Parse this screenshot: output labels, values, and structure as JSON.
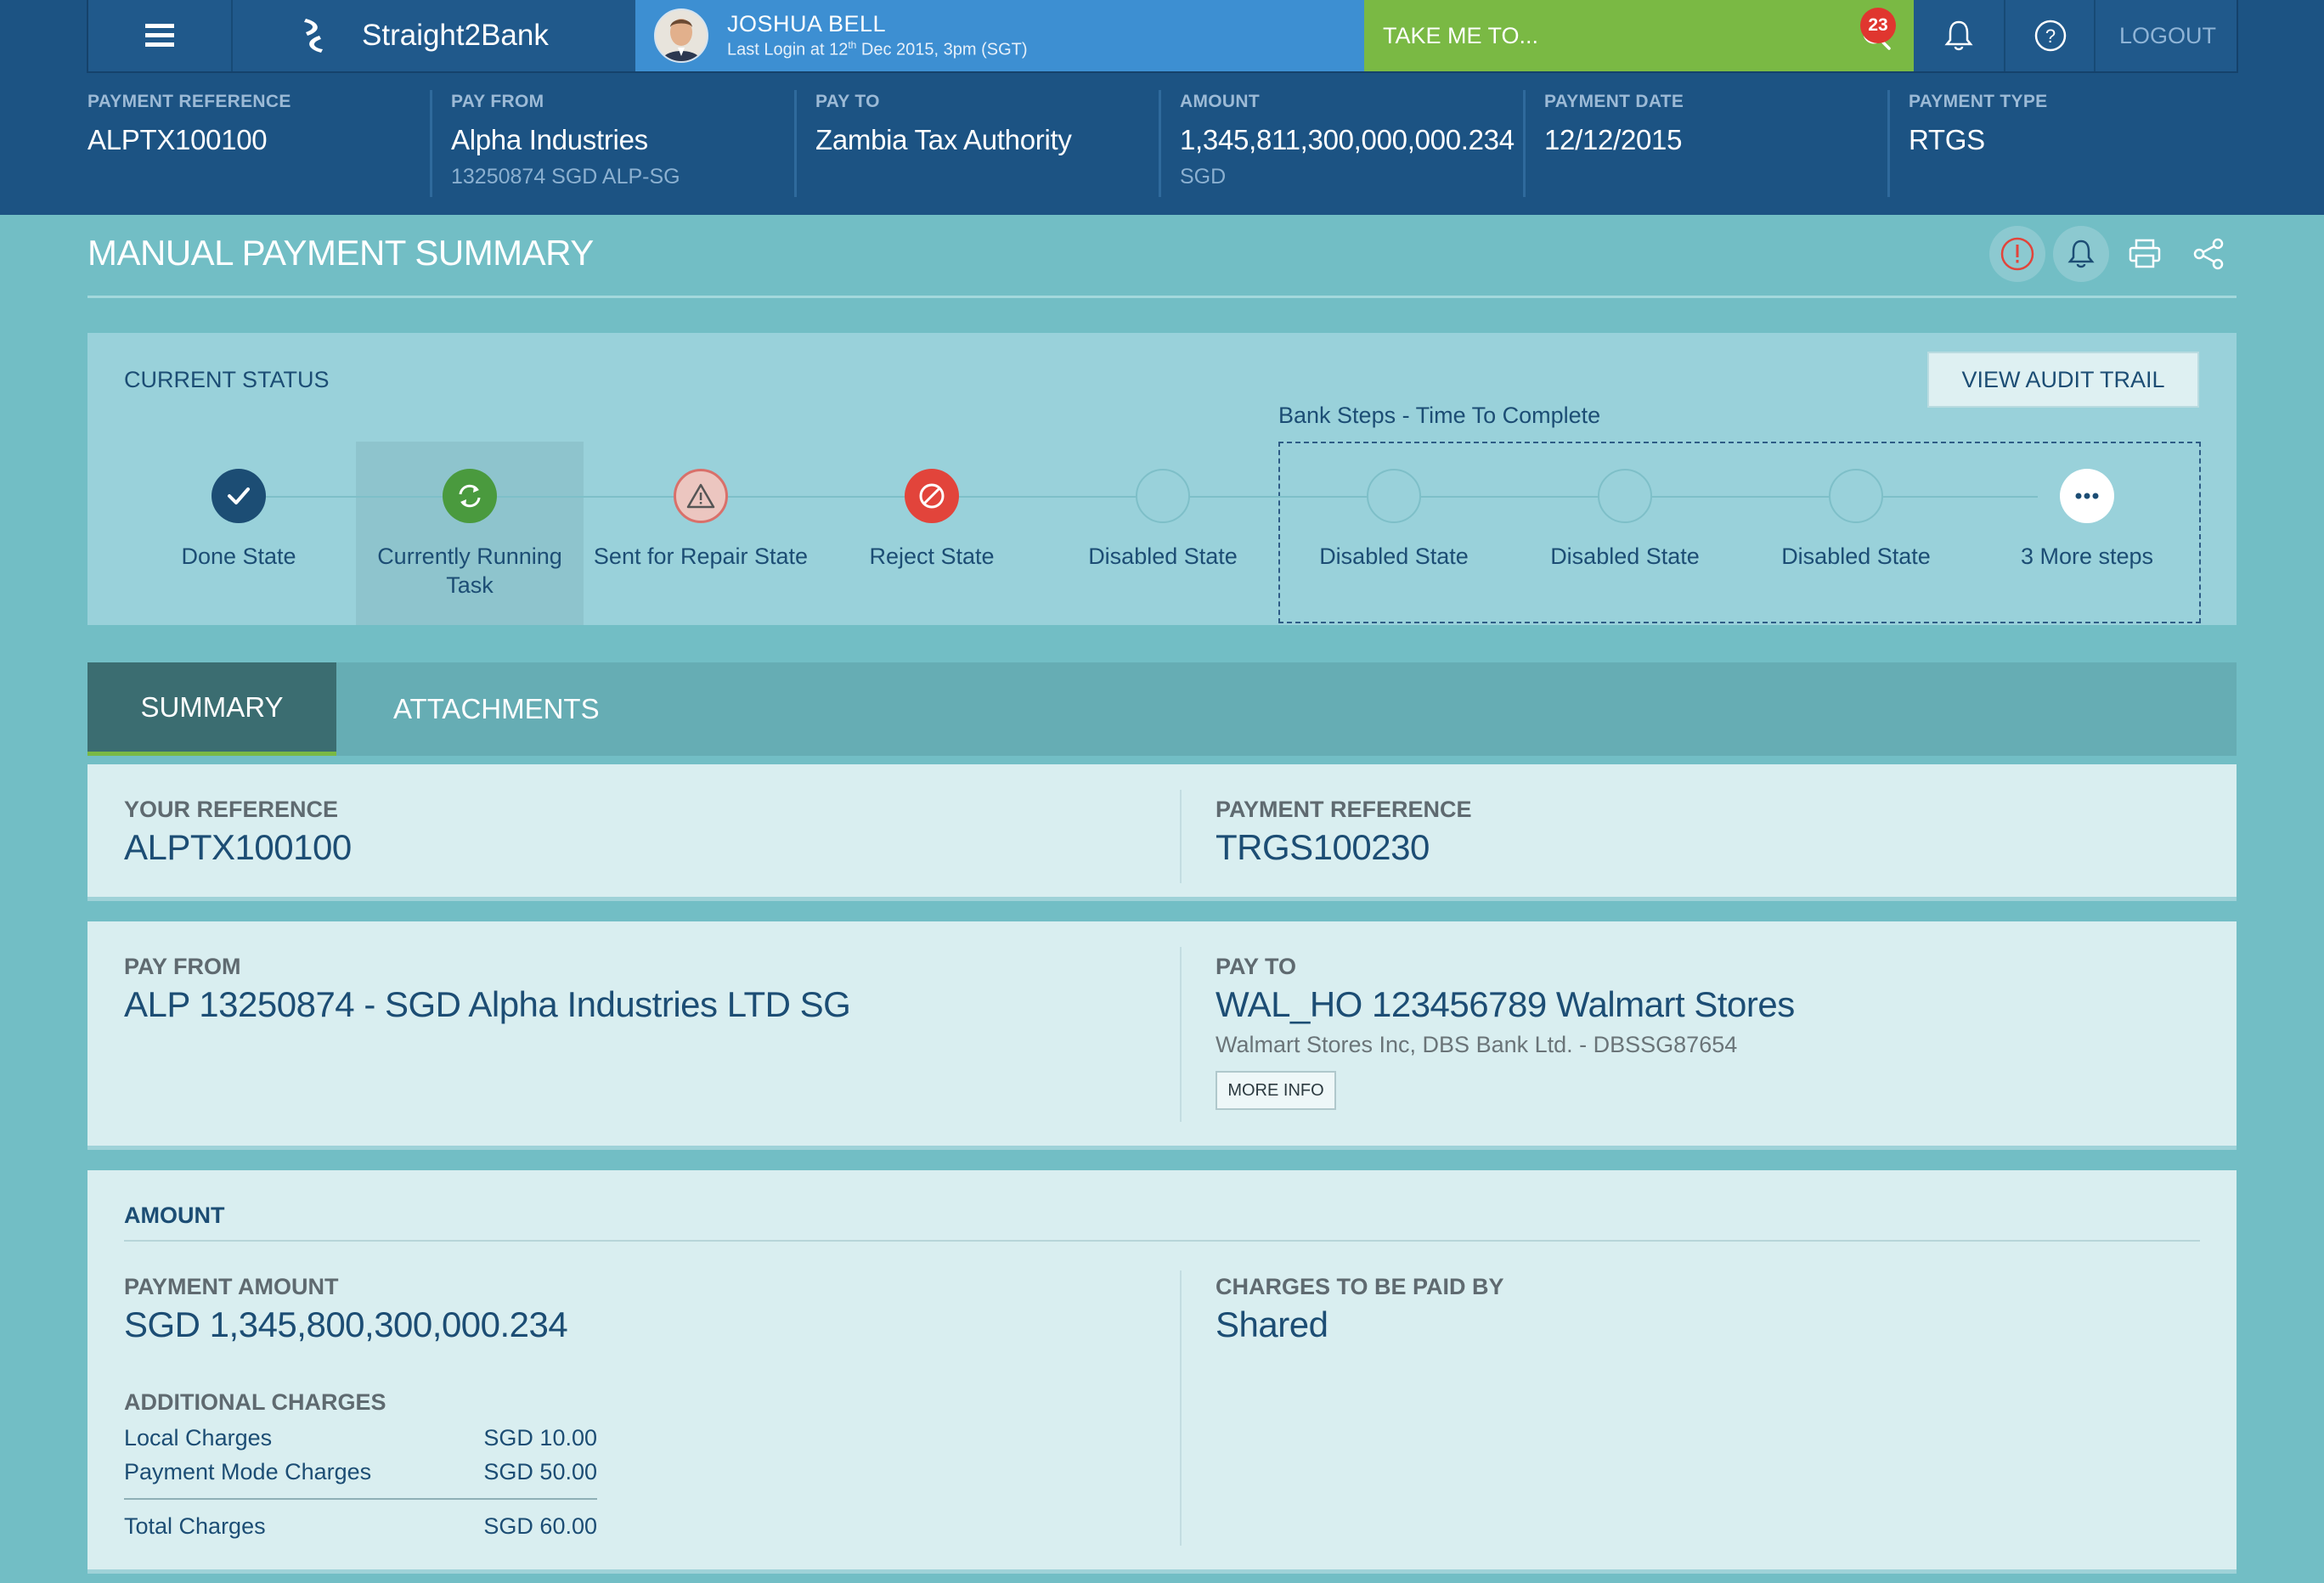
{
  "app": {
    "name": "Straight2Bank",
    "user_name": "JOSHUA BELL",
    "last_login_prefix": "Last Login at 12",
    "last_login_sup": "th",
    "last_login_suffix": " Dec 2015, 3pm (SGT)",
    "take_me_to": "TAKE ME TO...",
    "notification_count": "23",
    "logout": "LOGOUT",
    "icons": [
      "menu-icon",
      "bank-logo-icon",
      "search-icon",
      "bell-icon",
      "help-icon"
    ]
  },
  "header": [
    {
      "label": "PAYMENT REFERENCE",
      "value": "ALPTX100100",
      "sub": ""
    },
    {
      "label": "PAY FROM",
      "value": "Alpha Industries",
      "sub": "13250874 SGD ALP-SG"
    },
    {
      "label": "PAY TO",
      "value": "Zambia Tax Authority",
      "sub": ""
    },
    {
      "label": "AMOUNT",
      "value": "1,345,811,300,000,000.234",
      "sub": "SGD"
    },
    {
      "label": "PAYMENT DATE",
      "value": "12/12/2015",
      "sub": ""
    },
    {
      "label": "PAYMENT TYPE",
      "value": "RTGS",
      "sub": ""
    }
  ],
  "page": {
    "title": "MANUAL PAYMENT SUMMARY",
    "action_icons": [
      "alert-icon",
      "bell-icon",
      "print-icon",
      "share-icon"
    ]
  },
  "status": {
    "label": "CURRENT STATUS",
    "audit_button": "VIEW AUDIT TRAIL",
    "bank_steps_label": "Bank Steps - Time To Complete",
    "steps": [
      {
        "label": "Done State",
        "state": "done"
      },
      {
        "label": "Currently Running Task",
        "state": "running"
      },
      {
        "label": "Sent for Repair State",
        "state": "repair"
      },
      {
        "label": "Reject State",
        "state": "reject"
      },
      {
        "label": "Disabled State",
        "state": "disabled"
      },
      {
        "label": "Disabled State",
        "state": "disabled"
      },
      {
        "label": "Disabled State",
        "state": "disabled"
      },
      {
        "label": "Disabled State",
        "state": "disabled"
      },
      {
        "label": "3 More steps",
        "state": "more"
      }
    ]
  },
  "tabs": [
    {
      "label": "SUMMARY",
      "active": true
    },
    {
      "label": "ATTACHMENTS",
      "active": false
    }
  ],
  "summary": {
    "your_reference_label": "YOUR REFERENCE",
    "your_reference": "ALPTX100100",
    "payment_reference_label": "PAYMENT REFERENCE",
    "payment_reference": "TRGS100230",
    "pay_from_label": "PAY FROM",
    "pay_from": "ALP 13250874 - SGD Alpha Industries LTD SG",
    "pay_to_label": "PAY TO",
    "pay_to": "WAL_HO 123456789 Walmart Stores",
    "pay_to_sub": "Walmart Stores Inc, DBS Bank Ltd. - DBSSG87654",
    "more_info": "MORE INFO"
  },
  "amount": {
    "section_label": "AMOUNT",
    "payment_amount_label": "PAYMENT AMOUNT",
    "payment_amount": "SGD 1,345,800,300,000.234",
    "charges_paid_by_label": "CHARGES TO BE PAID BY",
    "charges_paid_by": "Shared",
    "additional_charges_label": "ADDITIONAL CHARGES",
    "charges": [
      {
        "name": "Local Charges",
        "value": "SGD 10.00"
      },
      {
        "name": "Payment Mode Charges",
        "value": "SGD 50.00"
      }
    ],
    "total_label": "Total Charges",
    "total_value": "SGD 60.00"
  },
  "colors": {
    "header": "#1c5383",
    "user_panel": "#3d8fd2",
    "take_me_to": "#7ab944",
    "page_bg": "#72bec5",
    "done": "#1c4d74",
    "running": "#4a9a3e",
    "reject": "#e2443b"
  }
}
